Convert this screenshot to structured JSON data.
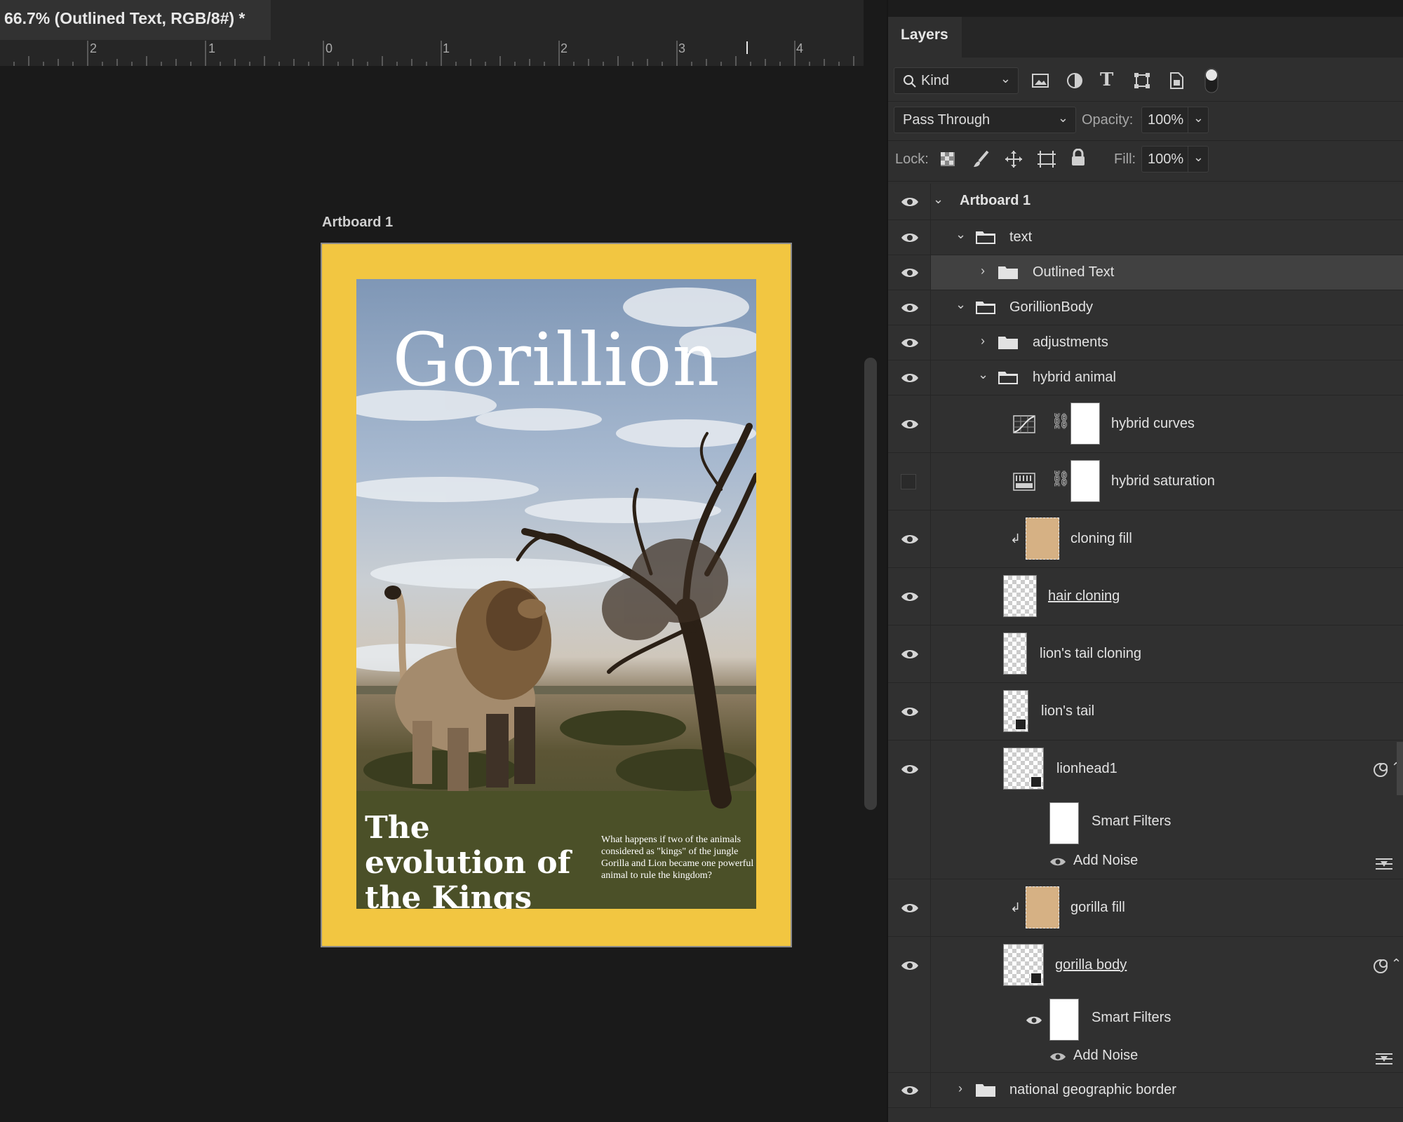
{
  "document": {
    "tab_title": "66.7% (Outlined Text, RGB/8#) *",
    "ruler_numbers": [
      "2",
      "1",
      "0",
      "1",
      "2",
      "3",
      "4"
    ]
  },
  "artboard": {
    "label": "Artboard 1",
    "background_color": "#f2c641",
    "cover_title": "Gorillion",
    "headline": "The evolution of the Kings",
    "blurb": "What happens if two of the animals considered as \"kings\" of the jungle Gorilla and Lion became one powerful animal to rule the kingdom?"
  },
  "layers_panel": {
    "tab": "Layers",
    "filter_kind": "Kind",
    "filter_icons": [
      "image-filter-icon",
      "adjustment-filter-icon",
      "type-filter-icon",
      "shape-filter-icon",
      "smart-object-filter-icon",
      "filter-toggle-icon"
    ],
    "blend_mode": "Pass Through",
    "opacity_label": "Opacity:",
    "opacity_value": "100%",
    "lock_label": "Lock:",
    "fill_label": "Fill:",
    "fill_value": "100%",
    "layers": [
      {
        "name": "Artboard 1",
        "type": "artboard",
        "expanded": true,
        "visible": true
      },
      {
        "name": "text",
        "type": "group",
        "expanded": true,
        "visible": true
      },
      {
        "name": "Outlined Text",
        "type": "group",
        "expanded": false,
        "visible": true,
        "selected": true
      },
      {
        "name": "GorillionBody",
        "type": "group",
        "expanded": true,
        "visible": true
      },
      {
        "name": "adjustments",
        "type": "group",
        "expanded": false,
        "visible": true
      },
      {
        "name": "hybrid animal",
        "type": "group",
        "expanded": true,
        "visible": true
      },
      {
        "name": "hybrid curves",
        "type": "curves-adjustment",
        "visible": true
      },
      {
        "name": "hybrid saturation",
        "type": "hue-saturation-adjustment",
        "visible": false
      },
      {
        "name": "cloning fill",
        "type": "fill",
        "clipped": true,
        "visible": true
      },
      {
        "name": "hair cloning",
        "type": "pixel",
        "visible": true
      },
      {
        "name": "lion's tail cloning",
        "type": "pixel",
        "visible": true
      },
      {
        "name": "lion's tail",
        "type": "smart-object",
        "visible": true
      },
      {
        "name": "lionhead1",
        "type": "smart-object",
        "visible": true,
        "smart_filters": {
          "label": "Smart Filters",
          "filter": "Add Noise"
        }
      },
      {
        "name": "gorilla fill",
        "type": "fill",
        "clipped": true,
        "visible": true
      },
      {
        "name": "gorilla body",
        "type": "smart-object",
        "visible": true,
        "smart_filters": {
          "label": "Smart Filters",
          "filter": "Add Noise"
        }
      },
      {
        "name": "national geographic border",
        "type": "group",
        "expanded": false,
        "visible": true
      }
    ]
  }
}
